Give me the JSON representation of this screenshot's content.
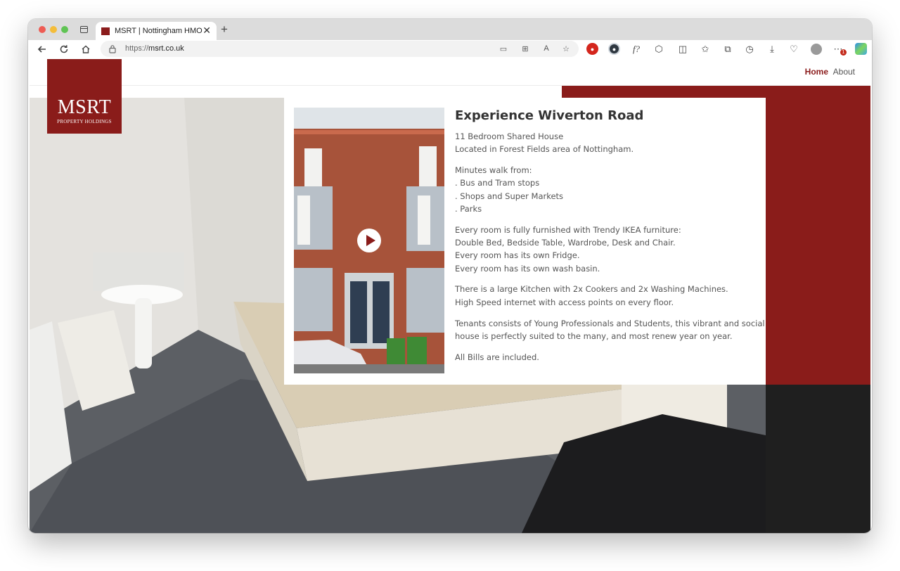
{
  "browser": {
    "tab_title": "MSRT | Nottingham HMO",
    "close_glyph": "✕",
    "new_tab_glyph": "+",
    "url_protocol": "https://",
    "url_host": "msrt.co.uk",
    "notification_badge": "1"
  },
  "site": {
    "logo": {
      "main": "MSRT",
      "sub": "PROPERTY HOLDINGS"
    },
    "nav": {
      "home": "Home",
      "about": "About"
    },
    "colors": {
      "brand_red": "#8a1c1a",
      "dark": "#1f1f1f"
    }
  },
  "content": {
    "title": "Experience Wiverton Road",
    "paragraphs": [
      [
        "11 Bedroom Shared House",
        "Located in Forest Fields area of Nottingham."
      ],
      [
        "Minutes walk from:",
        ". Bus and Tram stops",
        ". Shops and Super Markets",
        ". Parks"
      ],
      [
        "Every room is fully furnished with Trendy IKEA furniture:",
        "Double Bed, Bedside Table, Wardrobe, Desk and Chair.",
        "Every room has its own Fridge.",
        "Every room has its own wash basin."
      ],
      [
        "There is a large Kitchen with 2x Cookers and 2x Washing Machines.",
        "High Speed internet with access points on every floor."
      ],
      [
        "Tenants consists of Young Professionals and Students, this vibrant and social",
        "house is perfectly suited to the many, and most renew year on year."
      ],
      [
        "All Bills are included."
      ]
    ]
  }
}
